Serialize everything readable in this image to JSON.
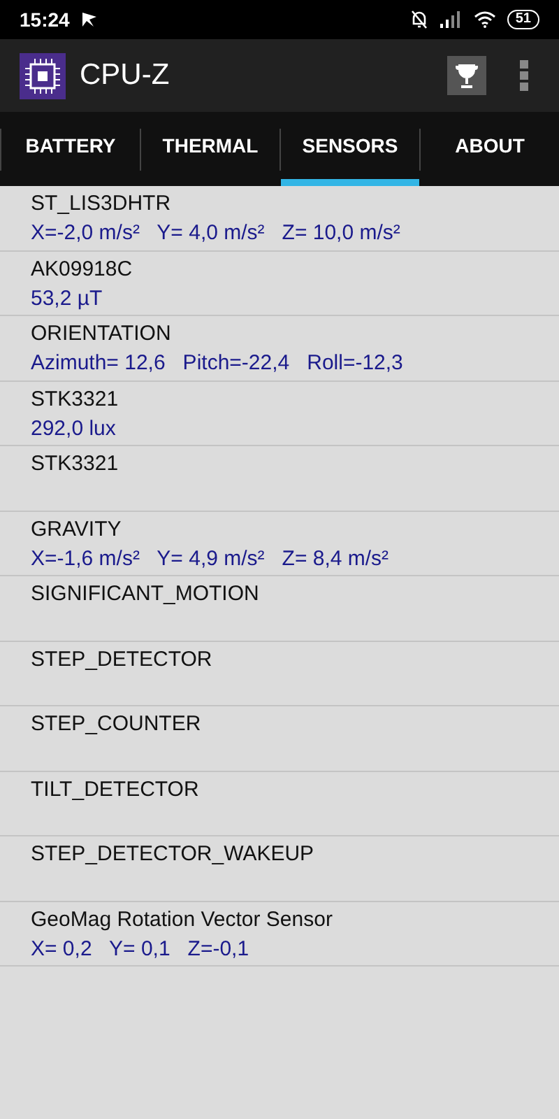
{
  "status_bar": {
    "time": "15:24",
    "battery": "51"
  },
  "app_bar": {
    "title": "CPU-Z"
  },
  "tabs": [
    {
      "label": "BATTERY",
      "selected": false
    },
    {
      "label": "THERMAL",
      "selected": false
    },
    {
      "label": "SENSORS",
      "selected": true
    },
    {
      "label": "ABOUT",
      "selected": false
    }
  ],
  "sensors": [
    {
      "name": "ST_LIS3DHTR",
      "value": "X=-2,0 m/s²   Y= 4,0 m/s²   Z= 10,0 m/s²"
    },
    {
      "name": "AK09918C",
      "value": "53,2 µT"
    },
    {
      "name": "ORIENTATION",
      "value": "Azimuth= 12,6   Pitch=-22,4   Roll=-12,3"
    },
    {
      "name": "STK3321",
      "value": "292,0 lux"
    },
    {
      "name": "STK3321"
    },
    {
      "name": "GRAVITY",
      "value": "X=-1,6 m/s²   Y= 4,9 m/s²   Z= 8,4 m/s²"
    },
    {
      "name": "SIGNIFICANT_MOTION"
    },
    {
      "name": "STEP_DETECTOR"
    },
    {
      "name": "STEP_COUNTER"
    },
    {
      "name": "TILT_DETECTOR"
    },
    {
      "name": "STEP_DETECTOR_WAKEUP"
    },
    {
      "name": "GeoMag Rotation Vector Sensor",
      "value": "X= 0,2   Y= 0,1   Z=-0,1"
    }
  ]
}
